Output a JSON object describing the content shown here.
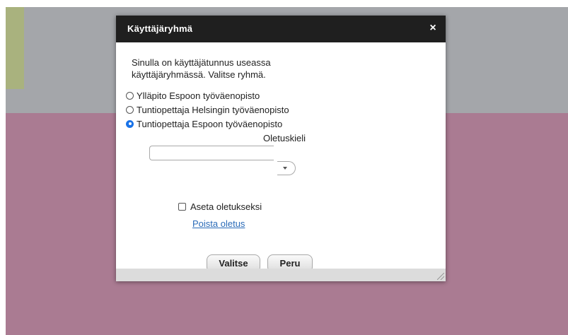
{
  "dialog": {
    "title": "Käyttäjäryhmä",
    "close_label": "×",
    "message": "Sinulla on käyttäjätunnus useassa käyttäjäryhmässä. Valitse ryhmä.",
    "groups": [
      {
        "label": "Ylläpito Espoon työväenopisto",
        "checked": false
      },
      {
        "label": "Tuntiopettaja Helsingin työväenopisto",
        "checked": false
      },
      {
        "label": "Tuntiopettaja Espoon työväenopisto",
        "checked": true
      }
    ],
    "language_label": "Oletuskieli",
    "language_value": "",
    "set_default_label": "Aseta oletukseksi",
    "set_default_checked": false,
    "remove_default_link": "Poista oletus",
    "select_button": "Valitse",
    "cancel_button": "Peru"
  },
  "colors": {
    "page_background": "#aa7b92",
    "top_background": "#a4a6aa",
    "side_bar": "#a9b27e",
    "titlebar": "#1f1f1f",
    "link": "#2a6bb8",
    "radio_selected": "#1a73e8"
  },
  "icons": {
    "close": "close-icon",
    "dropdown": "chevron-down-icon",
    "resize": "resize-grip-icon"
  }
}
